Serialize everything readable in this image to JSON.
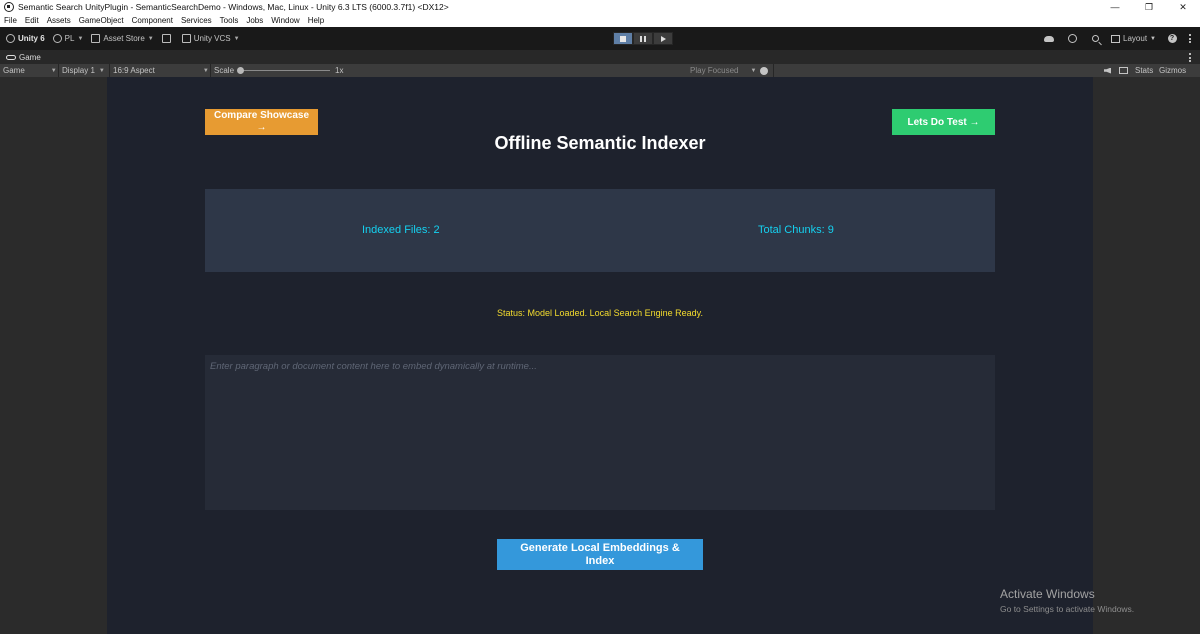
{
  "window": {
    "title": "Semantic Search UnityPlugin - SemanticSearchDemo - Windows, Mac, Linux - Unity 6.3 LTS (6000.3.7f1) <DX12>",
    "controls": [
      "—",
      "❐",
      "✕"
    ]
  },
  "menu": {
    "items": [
      "File",
      "Edit",
      "Assets",
      "GameObject",
      "Component",
      "Services",
      "Tools",
      "Jobs",
      "Window",
      "Help"
    ]
  },
  "toolbar": {
    "unity_label": "Unity 6",
    "account_label": "PL",
    "asset_store_label": "Asset Store",
    "vcs_label": "Unity VCS",
    "layout_label": "Layout",
    "help_glyph": "?",
    "caret": "▼"
  },
  "tab": {
    "label": "Game"
  },
  "game_options": {
    "mode": "Game",
    "display": "Display 1",
    "aspect": "16:9 Aspect",
    "scale_label": "Scale",
    "scale_value": "1x",
    "scale_level": 0,
    "play_focused": "Play Focused",
    "stats": "Stats",
    "gizmos": "Gizmos"
  },
  "app": {
    "compare_button": "Compare Showcase →",
    "test_button": "Lets Do Test →",
    "title": "Offline Semantic Indexer",
    "indexed_files": "Indexed Files: 2",
    "total_chunks": "Total Chunks: 9",
    "status": "Status: Model Loaded. Local Search Engine Ready.",
    "input_placeholder": "Enter paragraph or document content here to embed dynamically at runtime...",
    "generate_button": "Generate Local Embeddings & Index",
    "colors": {
      "background": "#1e222d",
      "panel": "#2e3748",
      "compare": "#e79b32",
      "test": "#2ecc71",
      "generate": "#3498db",
      "stat_text": "#15d1f0",
      "status_text": "#f4dc2e"
    }
  },
  "watermark": {
    "line1": "Activate Windows",
    "line2": "Go to Settings to activate Windows."
  }
}
